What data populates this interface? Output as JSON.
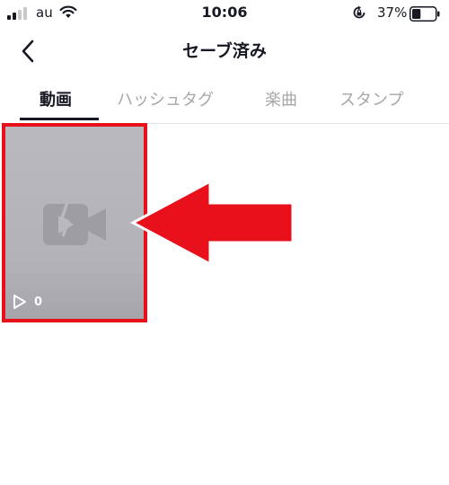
{
  "status_bar": {
    "carrier": "au",
    "time": "10:06",
    "battery_percent": "37%",
    "battery_level": 0.37,
    "icons": [
      "signal-icon",
      "wifi-icon",
      "rotation-lock-icon",
      "battery-icon"
    ]
  },
  "nav": {
    "title": "セーブ済み",
    "back_icon": "chevron-left-icon"
  },
  "tabs": [
    {
      "label": "動画",
      "active": true
    },
    {
      "label": "ハッシュタグ",
      "active": false
    },
    {
      "label": "楽曲",
      "active": false
    },
    {
      "label": "スタンプ",
      "active": false
    }
  ],
  "videos": [
    {
      "play_count": "0",
      "icon": "broken-video-icon"
    }
  ],
  "colors": {
    "accent_red": "#e8101a",
    "tab_active": "#161823",
    "tab_inactive": "#a6a7ab",
    "thumbnail_bg": "#b5b5ba"
  }
}
